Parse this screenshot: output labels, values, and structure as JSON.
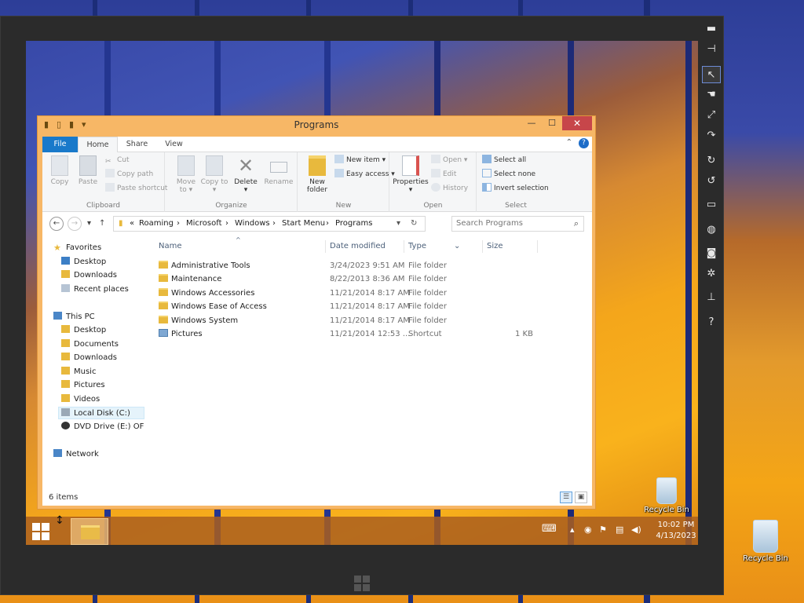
{
  "explorer": {
    "title": "Programs",
    "controls": {
      "minimize": "—",
      "maximize": "☐",
      "close": "✕"
    },
    "ribbon_tabs": {
      "file": "File",
      "home": "Home",
      "share": "Share",
      "view": "View"
    },
    "ribbon": {
      "clipboard": {
        "label": "Clipboard",
        "copy": "Copy",
        "paste": "Paste",
        "cut": "Cut",
        "copy_path": "Copy path",
        "paste_shortcut": "Paste shortcut"
      },
      "organize": {
        "label": "Organize",
        "move_to": "Move to ▾",
        "copy_to": "Copy to ▾",
        "delete": "Delete ▾",
        "rename": "Rename"
      },
      "new": {
        "label": "New",
        "new_folder": "New folder",
        "new_item": "New item ▾",
        "easy_access": "Easy access ▾"
      },
      "open": {
        "label": "Open",
        "properties": "Properties ▾",
        "open": "Open ▾",
        "edit": "Edit",
        "history": "History"
      },
      "select": {
        "label": "Select",
        "select_all": "Select all",
        "select_none": "Select none",
        "invert_selection": "Invert selection"
      }
    },
    "address": {
      "prefix": "«",
      "crumbs": [
        "Roaming",
        "Microsoft",
        "Windows",
        "Start Menu",
        "Programs"
      ],
      "separator": "›"
    },
    "search_placeholder": "Search Programs",
    "nav": {
      "favorites": "Favorites",
      "fav_items": [
        "Desktop",
        "Downloads",
        "Recent places"
      ],
      "this_pc": "This PC",
      "pc_items": [
        "Desktop",
        "Documents",
        "Downloads",
        "Music",
        "Pictures",
        "Videos",
        "Local Disk (C:)",
        "DVD Drive (E:) OFFIC"
      ],
      "network": "Network"
    },
    "columns": {
      "name": "Name",
      "date": "Date modified",
      "type": "Type",
      "size": "Size"
    },
    "files": [
      {
        "name": "Administrative Tools",
        "date": "3/24/2023 9:51 AM",
        "type": "File folder",
        "size": ""
      },
      {
        "name": "Maintenance",
        "date": "8/22/2013 8:36 AM",
        "type": "File folder",
        "size": ""
      },
      {
        "name": "Windows Accessories",
        "date": "11/21/2014 8:17 AM",
        "type": "File folder",
        "size": ""
      },
      {
        "name": "Windows Ease of Access",
        "date": "11/21/2014 8:17 AM",
        "type": "File folder",
        "size": ""
      },
      {
        "name": "Windows System",
        "date": "11/21/2014 8:17 AM",
        "type": "File folder",
        "size": ""
      },
      {
        "name": "Pictures",
        "date": "11/21/2014 12:53 ...",
        "type": "Shortcut",
        "size": "1 KB"
      }
    ],
    "status": "6 items"
  },
  "taskbar": {
    "time": "10:02 PM",
    "date": "4/13/2023"
  },
  "desktop": {
    "recycle_bin_inner": "Recycle Bin",
    "recycle_bin_outer": "Recycle Bin"
  }
}
